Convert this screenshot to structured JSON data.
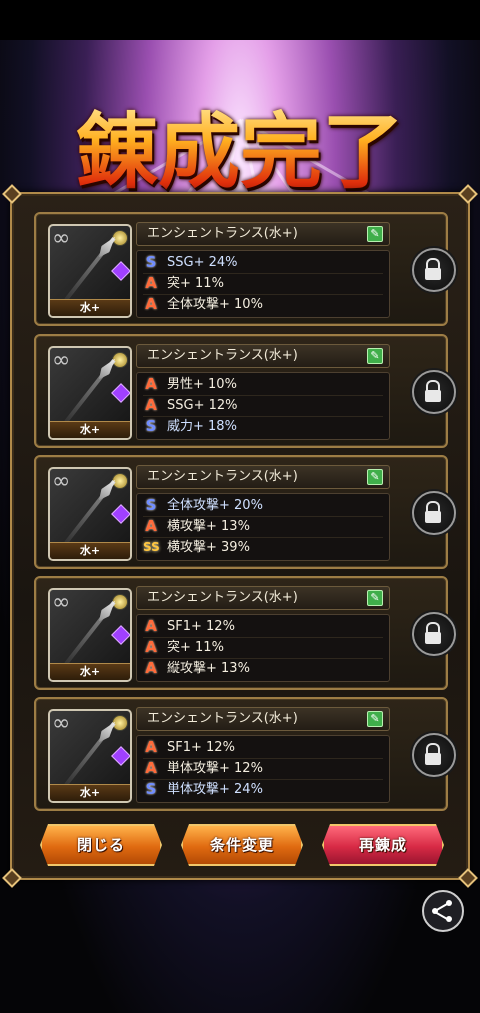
{
  "header": {
    "title": "錬成完了"
  },
  "cards": [
    {
      "name": "エンシェントランス(水+)",
      "element": "水+",
      "skills": [
        {
          "icon": "S",
          "kind": "s",
          "text": "SSG+ 24%"
        },
        {
          "icon": "A",
          "kind": "a",
          "text": "突+ 11%"
        },
        {
          "icon": "A",
          "kind": "a",
          "text": "全体攻撃+ 10%"
        }
      ]
    },
    {
      "name": "エンシェントランス(水+)",
      "element": "水+",
      "skills": [
        {
          "icon": "A",
          "kind": "a",
          "text": "男性+ 10%"
        },
        {
          "icon": "A",
          "kind": "a",
          "text": "SSG+ 12%"
        },
        {
          "icon": "S",
          "kind": "s",
          "text": "威力+ 18%"
        }
      ]
    },
    {
      "name": "エンシェントランス(水+)",
      "element": "水+",
      "skills": [
        {
          "icon": "S",
          "kind": "s",
          "text": "全体攻撃+ 20%"
        },
        {
          "icon": "A",
          "kind": "a",
          "text": "横攻撃+ 13%"
        },
        {
          "icon": "SS",
          "kind": "gold",
          "text": "横攻撃+ 39%"
        }
      ]
    },
    {
      "name": "エンシェントランス(水+)",
      "element": "水+",
      "skills": [
        {
          "icon": "A",
          "kind": "a",
          "text": "SF1+ 12%"
        },
        {
          "icon": "A",
          "kind": "a",
          "text": "突+ 11%"
        },
        {
          "icon": "A",
          "kind": "a",
          "text": "縦攻撃+ 13%"
        }
      ]
    },
    {
      "name": "エンシェントランス(水+)",
      "element": "水+",
      "skills": [
        {
          "icon": "A",
          "kind": "a",
          "text": "SF1+ 12%"
        },
        {
          "icon": "A",
          "kind": "a",
          "text": "単体攻撃+ 12%"
        },
        {
          "icon": "S",
          "kind": "s",
          "text": "単体攻撃+ 24%"
        }
      ]
    }
  ],
  "buttons": {
    "close": "閉じる",
    "change_conditions": "条件変更",
    "reforge": "再錬成"
  },
  "icons": {
    "edit": "edit-icon",
    "lock": "unlock-icon",
    "share": "share-icon"
  },
  "colors": {
    "button_orange": "#e06a10",
    "button_red": "#d72a45",
    "panel_border": "#b08a4a"
  }
}
